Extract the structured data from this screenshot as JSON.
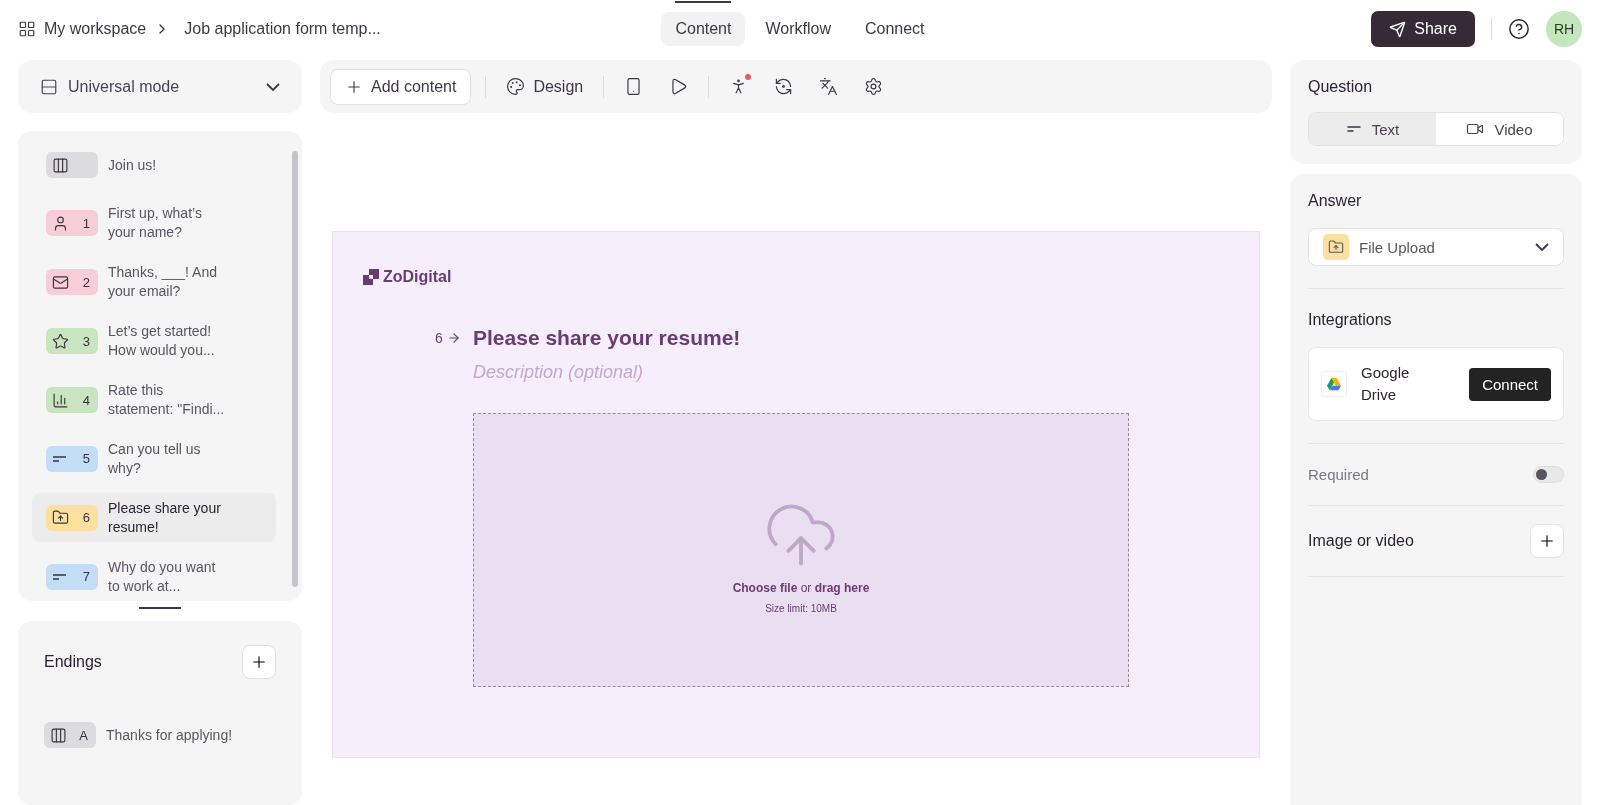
{
  "breadcrumb": {
    "workspace": "My workspace",
    "form": "Job application form temp..."
  },
  "nav_tabs": [
    {
      "label": "Content",
      "selected": true
    },
    {
      "label": "Workflow",
      "selected": false
    },
    {
      "label": "Connect",
      "selected": false
    }
  ],
  "share_button": "Share",
  "avatar": "RH",
  "mode_select": "Universal mode",
  "toolbar": {
    "add_content": "Add content",
    "design": "Design"
  },
  "questions": [
    {
      "kind": "statement",
      "title": "Join us!",
      "color": "#dcdcde",
      "selected": false
    },
    {
      "kind": "contact",
      "number": "1",
      "title": "First up, what’s your name?",
      "color": "#f6cdd8",
      "selected": false
    },
    {
      "kind": "email",
      "number": "2",
      "title": "Thanks, ___! And your email?",
      "color": "#f6cdd8",
      "selected": false
    },
    {
      "kind": "rating",
      "number": "3",
      "title": "Let’s get started! How would you...",
      "color": "#c8e5c0",
      "selected": false
    },
    {
      "kind": "opinion",
      "number": "4",
      "title": "Rate this statement: \"Findi...",
      "color": "#c8e5c0",
      "selected": false
    },
    {
      "kind": "text",
      "number": "5",
      "title": "Can you tell us why?",
      "color": "#c3ddf6",
      "selected": false
    },
    {
      "kind": "upload",
      "number": "6",
      "title": "Please share your resume!",
      "color": "#fbe0a0",
      "selected": true
    },
    {
      "kind": "text",
      "number": "7",
      "title": "Why do you want to work at...",
      "color": "#c3ddf6",
      "selected": false
    }
  ],
  "endings": {
    "title": "Endings",
    "items": [
      {
        "number": "A",
        "title": "Thanks for applying!"
      }
    ]
  },
  "canvas": {
    "logo": "ZoDigital",
    "number": "6",
    "question": "Please share your resume!",
    "description_placeholder": "Description (optional)",
    "upload_choose": "Choose file",
    "upload_or": "or",
    "upload_drag": "drag here",
    "size_limit": "Size limit: 10MB"
  },
  "properties": {
    "question_title": "Question",
    "question_types": [
      {
        "kind": "text",
        "label": "Text",
        "selected": true
      },
      {
        "kind": "video",
        "label": "Video",
        "selected": false
      }
    ],
    "answer_title": "Answer",
    "answer_type": "File Upload",
    "integrations_title": "Integrations",
    "integration_name": "Google Drive",
    "connect_button": "Connect",
    "required_label": "Required",
    "required_on": false,
    "media_label": "Image or video"
  }
}
